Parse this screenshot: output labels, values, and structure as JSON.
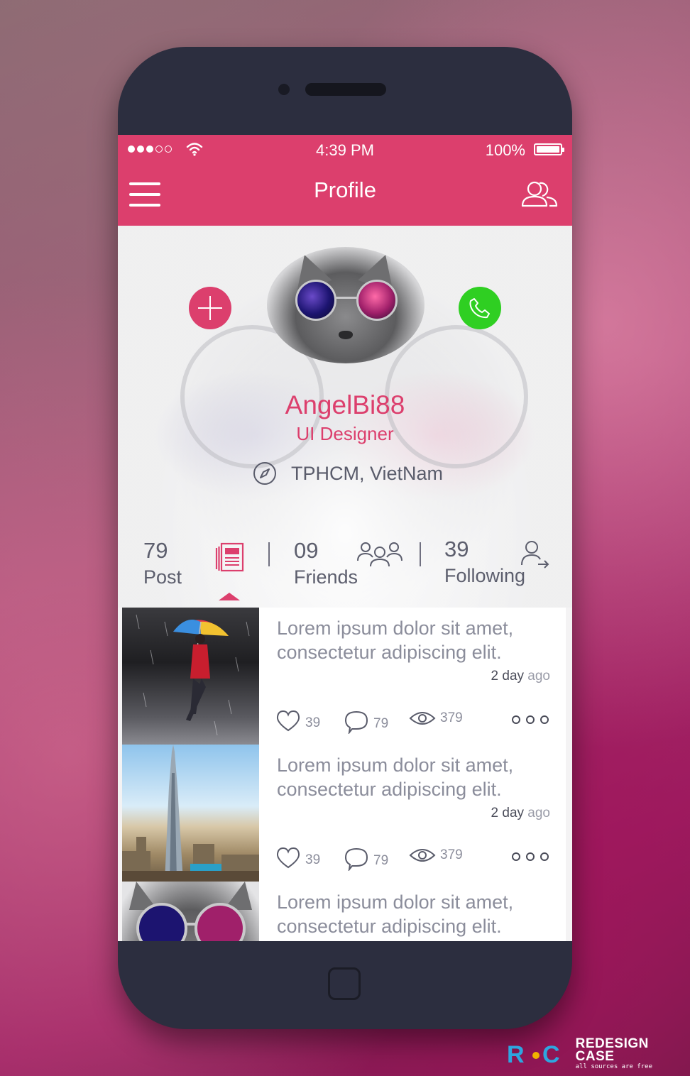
{
  "status_bar": {
    "signal_dots_filled": 3,
    "signal_dots_total": 5,
    "time": "4:39 PM",
    "battery_text": "100%",
    "battery_level": 1.0
  },
  "navbar": {
    "title": "Profile",
    "left_icon": "hamburger-menu-icon",
    "right_icon": "friends-icon"
  },
  "profile": {
    "username": "AngelBi88",
    "role": "UI Designer",
    "location": "TPHCM, VietNam",
    "location_icon": "compass-icon"
  },
  "stats": [
    {
      "value": "79",
      "label": "Post",
      "icon": "newspaper-icon",
      "selected": true
    },
    {
      "value": "09",
      "label": "Friends",
      "icon": "group-icon",
      "selected": false
    },
    {
      "value": "39",
      "label": "Following",
      "icon": "user-follow-icon",
      "selected": false
    }
  ],
  "posts": [
    {
      "title": "Lorem ipsum dolor sit amet, consectetur adipiscing elit.",
      "time_num": "2 day",
      "time_unit": "ago",
      "likes": "39",
      "comments": "79",
      "views": "379"
    },
    {
      "title": "Lorem ipsum dolor sit amet, consectetur adipiscing elit.",
      "time_num": "2 day",
      "time_unit": "ago",
      "likes": "39",
      "comments": "79",
      "views": "379"
    },
    {
      "title": "Lorem ipsum dolor sit amet, consectetur adipiscing elit."
    }
  ],
  "branding": {
    "mark_left": "R",
    "mark_right": "C",
    "name": "REDESIGN CASE",
    "tagline": "all sources are free"
  },
  "colors": {
    "accent": "#dc3f6d",
    "call_green": "#2fcf22",
    "phone_body": "#2c2e3f",
    "text_gray": "#8b8d9b"
  }
}
